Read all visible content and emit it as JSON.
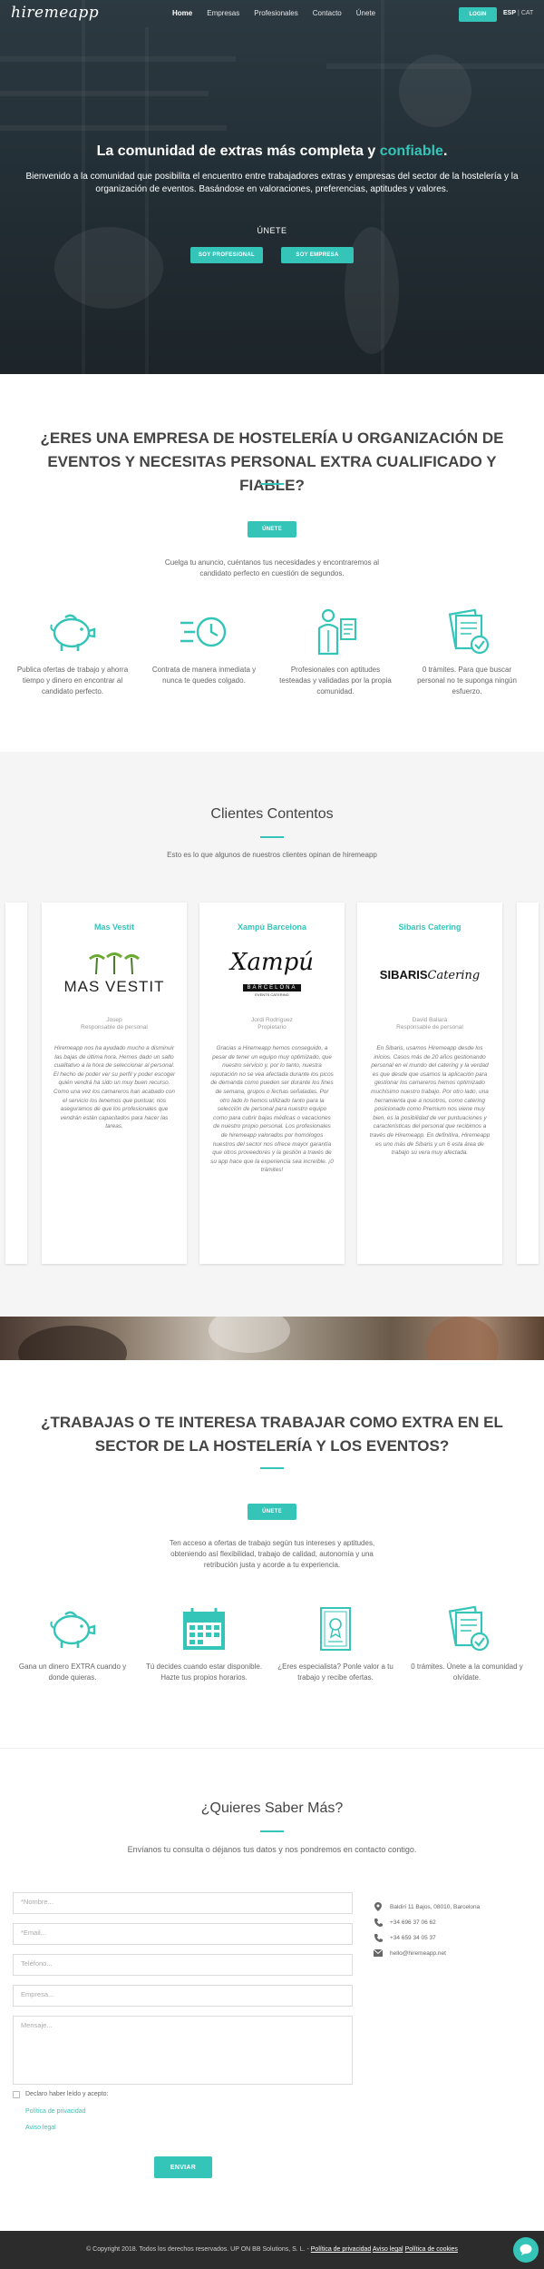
{
  "colors": {
    "accent": "#35c4b8",
    "hero_dark": "#2c3a41",
    "section_gray": "#f5f5f5",
    "footer": "#2c2c2c"
  },
  "nav": {
    "logo": "hiremeapp",
    "links": [
      "Home",
      "Empresas",
      "Profesionales",
      "Contacto",
      "Únete"
    ],
    "login": "LOGIN",
    "lang_active": "ESP",
    "lang_other": "CAT"
  },
  "hero": {
    "title_main": "La comunidad de extras más completa y ",
    "title_highlight": "confiable",
    "title_end": ".",
    "subtitle": "Bienvenido a la comunidad que posibilita el encuentro entre trabajadores extras y empresas del sector de la hostelería y la organización de eventos. Basándose en valoraciones, preferencias, aptitudes y valores.",
    "unete": "ÚNETE",
    "btn_profesional": "SOY PROFESIONAL",
    "btn_empresa": "SOY EMPRESA"
  },
  "empresas": {
    "title": "¿ERES UNA EMPRESA DE HOSTELERÍA U ORGANIZACIÓN DE EVENTOS Y NECESITAS PERSONAL EXTRA CUALIFICADO Y FIABLE?",
    "button": "ÚNETE",
    "text": "Cuelga tu anuncio, cuéntanos tus necesidades y encontraremos al candidato perfecto en cuestión de segundos.",
    "features": [
      {
        "icon": "piggy-bank-icon",
        "text": "Publica ofertas de trabajo y ahorra tiempo y dinero en encontrar al candidato perfecto."
      },
      {
        "icon": "fast-clock-icon",
        "text": "Contrata de manera inmediata y nunca te quedes colgado."
      },
      {
        "icon": "professional-person-icon",
        "text": "Profesionales con aptitudes testeadas y validadas por la propia comunidad."
      },
      {
        "icon": "document-check-icon",
        "text": "0 trámites. Para que buscar personal no te suponga ningún esfuerzo."
      }
    ]
  },
  "testimonials": {
    "title": "Clientes Contentos",
    "subtitle": "Esto es lo que algunos de nuestros clientes opinan de hiremeapp",
    "cards": [
      {
        "company": "Mas Vestit",
        "logo_text": "MAS VESTIT",
        "person": "Josep",
        "role": "Responsable de personal",
        "quote": "Hiremeapp nos ha ayudado mucho a disminuir las bajas de última hora. Hemos dado un salto cualitativo a la hora de seleccionar al personal. El hecho de poder ver su perfil y poder escoger quién vendrá ha sido un muy buen recurso. Como una vez los camareros han acabado con el servicio los tenemos que puntuar, nos aseguramos de que los profesionales que vendrán están capacitados para hacer las tareas."
      },
      {
        "company": "Xampú Barcelona",
        "logo_text": "Xampú",
        "logo_sub": "BARCELONA",
        "logo_tag": "EVENTS CATERING",
        "person": "Jordi Rodríguez",
        "role": "Propietario",
        "quote": "Gracias a Hiremeapp hemos conseguido, a pesar de tener un equipo muy optimizado, que nuestro servicio y, por lo tanto, nuestra reputación no se vea afectada durante los picos de demanda como pueden ser durante los fines de semana, grupos o fechas señaladas. Por otro lado lo hemos utilizado tanto para la selección de personal para nuestro equipo como para cubrir bajas médicas o vacaciones de nuestro propio personal. Los profesionales de hiremeapp valorados por homólogos nuestros del sector nos ofrece mayor garantía que otros proveedores y la gestión a través de su app hace que la experiencia sea increíble. ¡0 trámites!"
      },
      {
        "company": "Sibaris Catering",
        "logo_text": "SIBARIS",
        "logo_script": "Catering",
        "person": "David Ballarà",
        "role": "Responsable de personal",
        "quote": "En Sibaris, usamos Hiremeapp desde los inicios. Casos más de 20 años gestionando personal en el mundo del catering y la verdad es que desde que usamos la aplicación para gestionar los camareros hemos optimizado muchísimo nuestro trabajo. Por otro lado, una herramienta que a nosotros, como catering posicionado como Premium nos viene muy bien, es la posibilidad de ver puntuaciones y características del personal que recibimos a través de Hiremeapp. En definitiva, Hiremeapp es uno más de Sibaris y un 6 esta área de trabajo su vera muy afectada."
      }
    ]
  },
  "profesionales": {
    "title": "¿TRABAJAS O TE INTERESA TRABAJAR COMO EXTRA EN EL SECTOR DE LA HOSTELERÍA Y LOS EVENTOS?",
    "button": "ÚNETE",
    "text": "Ten acceso a ofertas de trabajo según tus intereses y aptitudes, obteniendo así flexibilidad, trabajo de calidad, autonomía y una retribución justa y acorde a tu experiencia.",
    "features": [
      {
        "icon": "piggy-bank-icon",
        "text": "Gana un dinero EXTRA cuando y donde quieras."
      },
      {
        "icon": "calendar-icon",
        "text": "Tú decides cuando estar disponible. Hazte tus propios horarios."
      },
      {
        "icon": "certificate-icon",
        "text": "¿Eres especialista? Ponle valor a tu trabajo y recibe ofertas."
      },
      {
        "icon": "document-check-icon",
        "text": "0 trámites. Únete a la comunidad y olvídate."
      }
    ]
  },
  "contact": {
    "title": "¿Quieres Saber Más?",
    "subtitle": "Envíanos tu consulta o déjanos tus datos y nos pondremos en contacto contigo.",
    "placeholders": {
      "name": "*Nombre...",
      "email": "*Email...",
      "phone": "Teléfono...",
      "company": "Empresa...",
      "message": "Mensaje..."
    },
    "consent": "Declaro haber leído y acepto:",
    "privacy_link": "Política de privacidad",
    "legal_link": "Aviso legal",
    "send": "ENVIAR",
    "info": [
      {
        "icon": "location-pin-icon",
        "text": "Baldiri 11 Bajos, 08010, Barcelona"
      },
      {
        "icon": "phone-icon",
        "text": "+34 696 37 06 62"
      },
      {
        "icon": "phone-icon",
        "text": "+34 659 34 05 37"
      },
      {
        "icon": "mail-icon",
        "text": "hello@hiremeapp.net"
      }
    ]
  },
  "footer": {
    "copyright": "© Copyright 2018. Todos los derechos reservados. UP ON BB Solutions, S. L. -",
    "privacy": "Política de privacidad",
    "legal": "Aviso legal",
    "cookies": "Política de cookies"
  }
}
